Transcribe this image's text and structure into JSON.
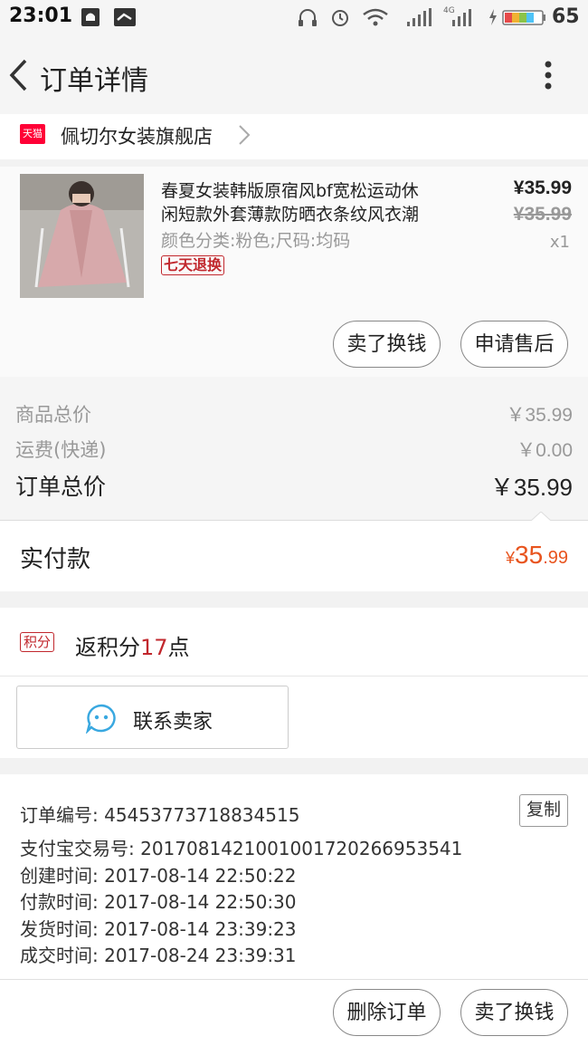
{
  "status_bar": {
    "time": "23:01",
    "battery": "65",
    "network": "4G"
  },
  "header": {
    "title": "订单详情"
  },
  "shop": {
    "badge": "天猫",
    "name": "佩切尔女装旗舰店"
  },
  "product": {
    "title_line1": "春夏女装韩版原宿风bf宽松运动休",
    "title_line2": "闲短款外套薄款防晒衣条纹风衣潮",
    "variant": "颜色分类:粉色;尺码:均码",
    "tag": "七天退换",
    "price": "¥35.99",
    "original_price": "¥35.99",
    "quantity": "x1",
    "buttons": {
      "sell": "卖了换钱",
      "after_sale": "申请售后"
    }
  },
  "totals": {
    "goods_label": "商品总价",
    "goods_value": "￥35.99",
    "shipping_label": "运费(快递)",
    "shipping_value": "￥0.00",
    "order_label": "订单总价",
    "order_value": "￥35.99"
  },
  "payment": {
    "label": "实付款",
    "currency": "¥",
    "integer": "35",
    "decimal": ".99"
  },
  "points": {
    "badge": "积分",
    "text_prefix": "返积分",
    "count": "17",
    "text_suffix": "点"
  },
  "contact": {
    "label": "联系卖家"
  },
  "order_info": {
    "copy_label": "复制",
    "lines": [
      "订单编号: 45453773718834515",
      "支付宝交易号: 2017081421001001720266953541",
      "创建时间: 2017-08-14 22:50:22",
      "付款时间: 2017-08-14 22:50:30",
      "发货时间: 2017-08-14 23:39:23",
      "成交时间: 2017-08-24 23:39:31"
    ]
  },
  "footer": {
    "delete_label": "删除订单",
    "sell_label": "卖了换钱"
  },
  "colors": {
    "accent": "#e8541e",
    "tmall_red": "#ff0036",
    "points_red": "#c1272d"
  }
}
